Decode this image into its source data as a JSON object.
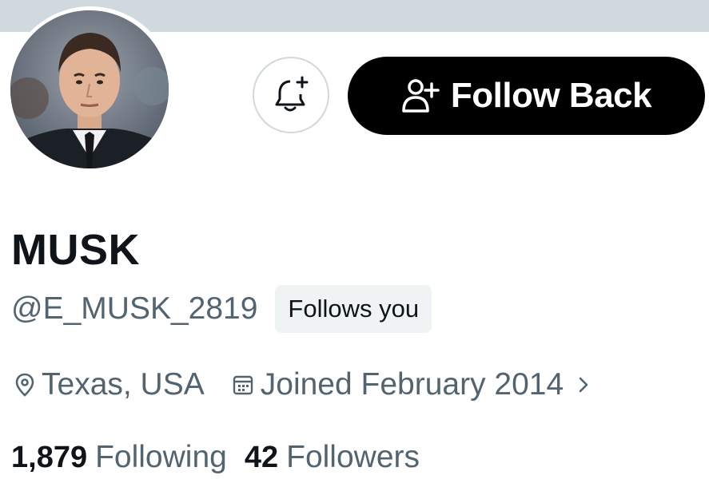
{
  "profile": {
    "display_name": "MUSK",
    "handle": "@E_MUSK_2819",
    "follows_you_badge": "Follows you",
    "location": "Texas, USA",
    "joined": "Joined February 2014",
    "stats": {
      "following_count": "1,879",
      "following_label": "Following",
      "followers_count": "42",
      "followers_label": "Followers"
    }
  },
  "actions": {
    "notify_icon": "bell-plus-icon",
    "follow_back_label": "Follow Back",
    "follow_back_icon": "person-plus-icon"
  },
  "icons": {
    "location": "location-pin-icon",
    "joined": "calendar-icon",
    "joined_chevron": "chevron-right-icon"
  },
  "colors": {
    "banner": "#cfd9de",
    "primary_text": "#0f1419",
    "secondary_text": "#536471",
    "button_black": "#000000",
    "badge_bg": "#eff3f4"
  }
}
